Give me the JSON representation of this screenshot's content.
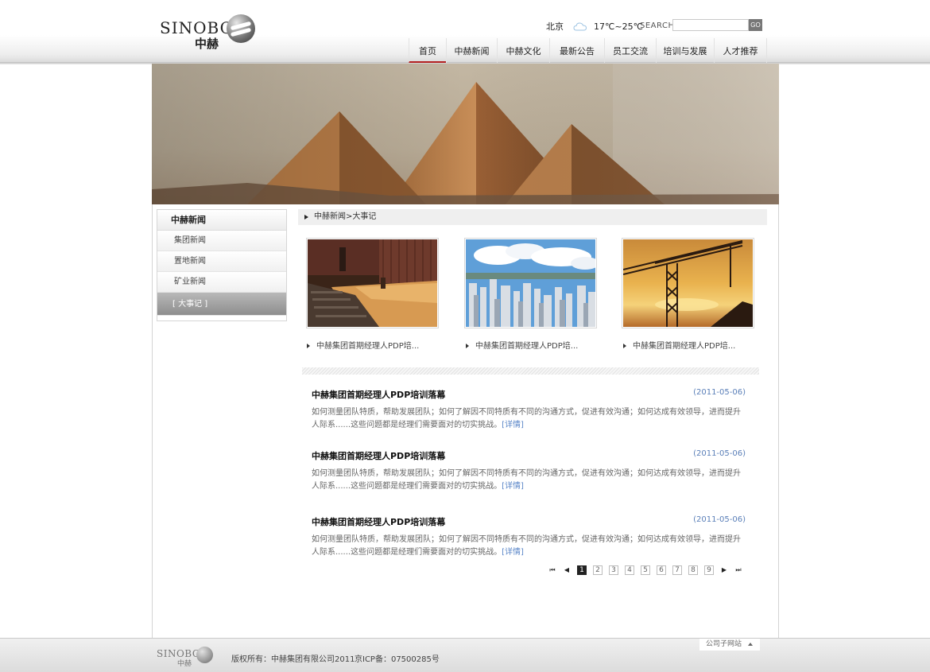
{
  "header": {
    "logo_en": "SINOBO",
    "logo_cn": "中赫",
    "weather_city": "北京",
    "weather_icon": "cloud-icon",
    "weather_temp": "17℃~25℃",
    "search_label": "SEARCH",
    "search_value": "",
    "search_placeholder": "",
    "search_button": "GO"
  },
  "nav": {
    "items": [
      {
        "label": "首页",
        "active": true
      },
      {
        "label": "中赫新闻"
      },
      {
        "label": "中赫文化"
      },
      {
        "label": "最新公告"
      },
      {
        "label": "员工交流"
      },
      {
        "label": "培训与发展"
      },
      {
        "label": "人才推荐"
      }
    ]
  },
  "sidebar": {
    "title": "中赫新闻",
    "items": [
      {
        "label": "集团新闻"
      },
      {
        "label": "置地新闻"
      },
      {
        "label": "矿业新闻"
      },
      {
        "label": "[ 大事记 ]",
        "active": true
      }
    ]
  },
  "breadcrumb": "中赫新闻>大事记",
  "photos": [
    {
      "caption": "中赫集团首期经理人PDP培...",
      "image": "auditorium"
    },
    {
      "caption": "中赫集团首期经理人PDP培...",
      "image": "city-skyline"
    },
    {
      "caption": "中赫集团首期经理人PDP培...",
      "image": "construction-crane"
    }
  ],
  "articles": [
    {
      "title": "中赫集团首期经理人PDP培训落幕",
      "date": "(2011-05-06)",
      "body": "如何测量团队特质，帮助发展团队；如何了解因不同特质有不同的沟通方式，促进有效沟通；如何达成有效领导，进而提升人际系......这些问题都是经理们需要面对的切实挑战。",
      "more": "[详情]"
    },
    {
      "title": "中赫集团首期经理人PDP培训落幕",
      "date": "(2011-05-06)",
      "body": "如何测量团队特质，帮助发展团队；如何了解因不同特质有不同的沟通方式，促进有效沟通；如何达成有效领导，进而提升人际系......这些问题都是经理们需要面对的切实挑战。",
      "more": "[详情]"
    },
    {
      "title": "中赫集团首期经理人PDP培训落幕",
      "date": "(2011-05-06)",
      "body": "如何测量团队特质，帮助发展团队；如何了解因不同特质有不同的沟通方式，促进有效沟通；如何达成有效领导，进而提升人际系......这些问题都是经理们需要面对的切实挑战。",
      "more": "[详情]"
    }
  ],
  "pager": {
    "first": "⏮",
    "prev": "◀",
    "next": "▶",
    "last": "⏭",
    "pages": [
      "1",
      "2",
      "3",
      "4",
      "5",
      "6",
      "7",
      "8",
      "9"
    ],
    "current": "1"
  },
  "footer": {
    "logo_en": "SINOBO",
    "logo_cn": "中赫",
    "copyright": "版权所有：中赫集团有限公司2011",
    "icp": "京ICP备：07500285号",
    "subsite": "公司子网站"
  }
}
